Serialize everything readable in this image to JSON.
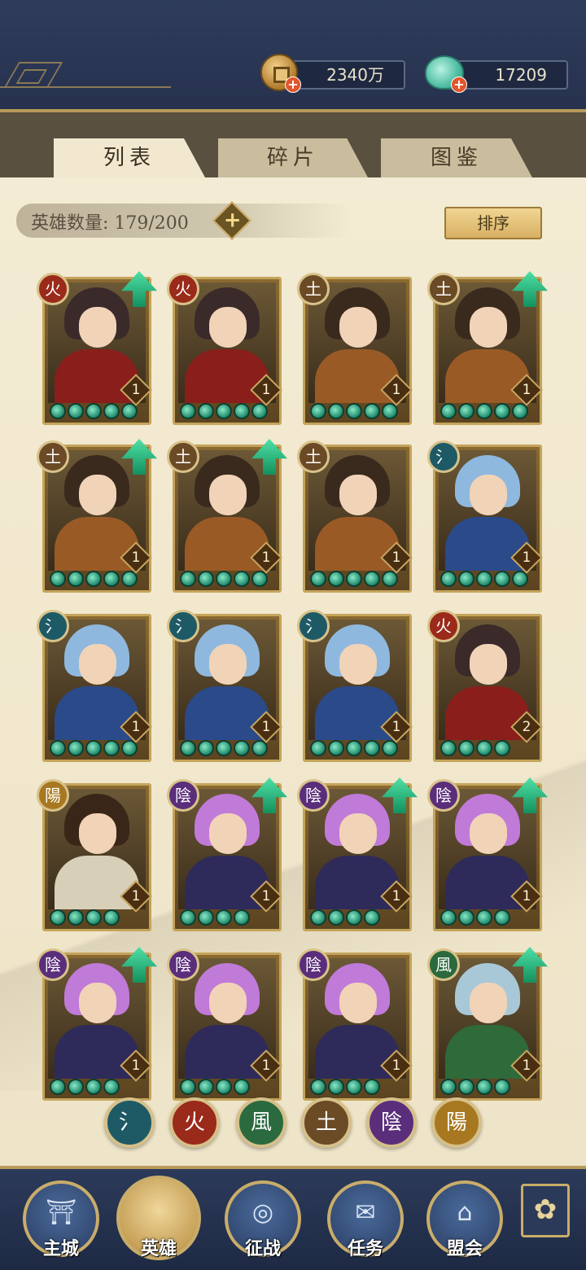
{
  "currency": {
    "coins": "2340万",
    "jade": "17209",
    "add_symbol": "+"
  },
  "tabs": [
    "列表",
    "碎片",
    "图鉴"
  ],
  "active_tab": "列表",
  "hero_count": {
    "label": "英雄数量: 179/200",
    "add_symbol": "+"
  },
  "sort_label": "排序",
  "element_glyphs": {
    "water": "氵",
    "fire": "火",
    "wood": "風",
    "earth": "土",
    "yin": "陰",
    "yang": "陽"
  },
  "heroes": [
    {
      "element": "fire",
      "level": "1",
      "stars": 5,
      "upgrade": true
    },
    {
      "element": "fire",
      "level": "1",
      "stars": 5,
      "upgrade": false
    },
    {
      "element": "earth",
      "level": "1",
      "stars": 5,
      "upgrade": false
    },
    {
      "element": "earth",
      "level": "1",
      "stars": 5,
      "upgrade": true
    },
    {
      "element": "earth",
      "level": "1",
      "stars": 5,
      "upgrade": true
    },
    {
      "element": "earth",
      "level": "1",
      "stars": 5,
      "upgrade": true
    },
    {
      "element": "earth",
      "level": "1",
      "stars": 5,
      "upgrade": false
    },
    {
      "element": "water",
      "level": "1",
      "stars": 5,
      "upgrade": false
    },
    {
      "element": "water",
      "level": "1",
      "stars": 5,
      "upgrade": false
    },
    {
      "element": "water",
      "level": "1",
      "stars": 5,
      "upgrade": false
    },
    {
      "element": "water",
      "level": "1",
      "stars": 5,
      "upgrade": false
    },
    {
      "element": "fire",
      "level": "2",
      "stars": 4,
      "upgrade": false
    },
    {
      "element": "yang",
      "level": "1",
      "stars": 4,
      "upgrade": false
    },
    {
      "element": "yin",
      "level": "1",
      "stars": 4,
      "upgrade": true
    },
    {
      "element": "yin",
      "level": "1",
      "stars": 4,
      "upgrade": true
    },
    {
      "element": "yin",
      "level": "1",
      "stars": 4,
      "upgrade": true
    },
    {
      "element": "yin",
      "level": "1",
      "stars": 4,
      "upgrade": true
    },
    {
      "element": "yin",
      "level": "1",
      "stars": 4,
      "upgrade": false
    },
    {
      "element": "yin",
      "level": "1",
      "stars": 4,
      "upgrade": false
    },
    {
      "element": "wood",
      "level": "1",
      "stars": 4,
      "upgrade": true
    }
  ],
  "filters": [
    "water",
    "fire",
    "wood",
    "earth",
    "yin",
    "yang"
  ],
  "nav": [
    {
      "label": "主城",
      "icon": "castle-icon"
    },
    {
      "label": "英雄",
      "icon": "hero-portrait-icon"
    },
    {
      "label": "征战",
      "icon": "battle-icon"
    },
    {
      "label": "任务",
      "icon": "scroll-icon"
    },
    {
      "label": "盟会",
      "icon": "alliance-icon"
    }
  ],
  "active_nav": "英雄"
}
